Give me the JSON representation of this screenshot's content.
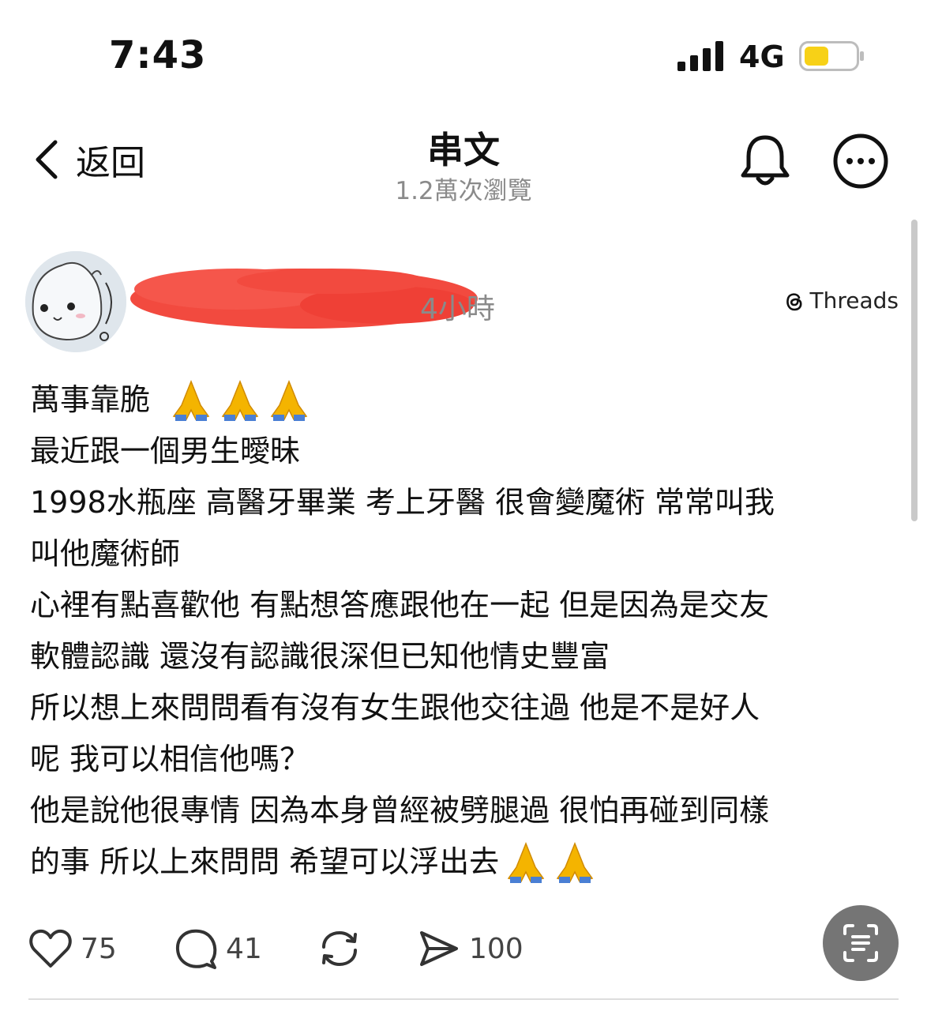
{
  "status": {
    "time": "7:43",
    "network": "4G"
  },
  "nav": {
    "back_label": "返回",
    "title": "串文",
    "subtitle": "1.2萬次瀏覽"
  },
  "post": {
    "time": "4小時",
    "source": "Threads",
    "lines": [
      "萬事靠脆",
      "最近跟一個男生曖昧",
      "1998水瓶座 高醫牙畢業 考上牙醫 很會變魔術 常常叫我",
      "叫他魔術師",
      "心裡有點喜歡他 有點想答應跟他在一起 但是因為是交友",
      "軟體認識 還沒有認識很深但已知他情史豐富",
      "所以想上來問問看有沒有女生跟他交往過 他是不是好人",
      "呢 我可以相信他嗎？",
      "他是說他很專情 因為本身曾經被劈腿過 很怕再碰到同樣",
      "的事 所以上來問問 希望可以浮出去"
    ]
  },
  "actions": {
    "likes": "75",
    "comments": "41",
    "shares": "100"
  },
  "colors": {
    "battery": "#f7d117",
    "redaction": "#f24a3f",
    "scan_button": "#757575"
  }
}
